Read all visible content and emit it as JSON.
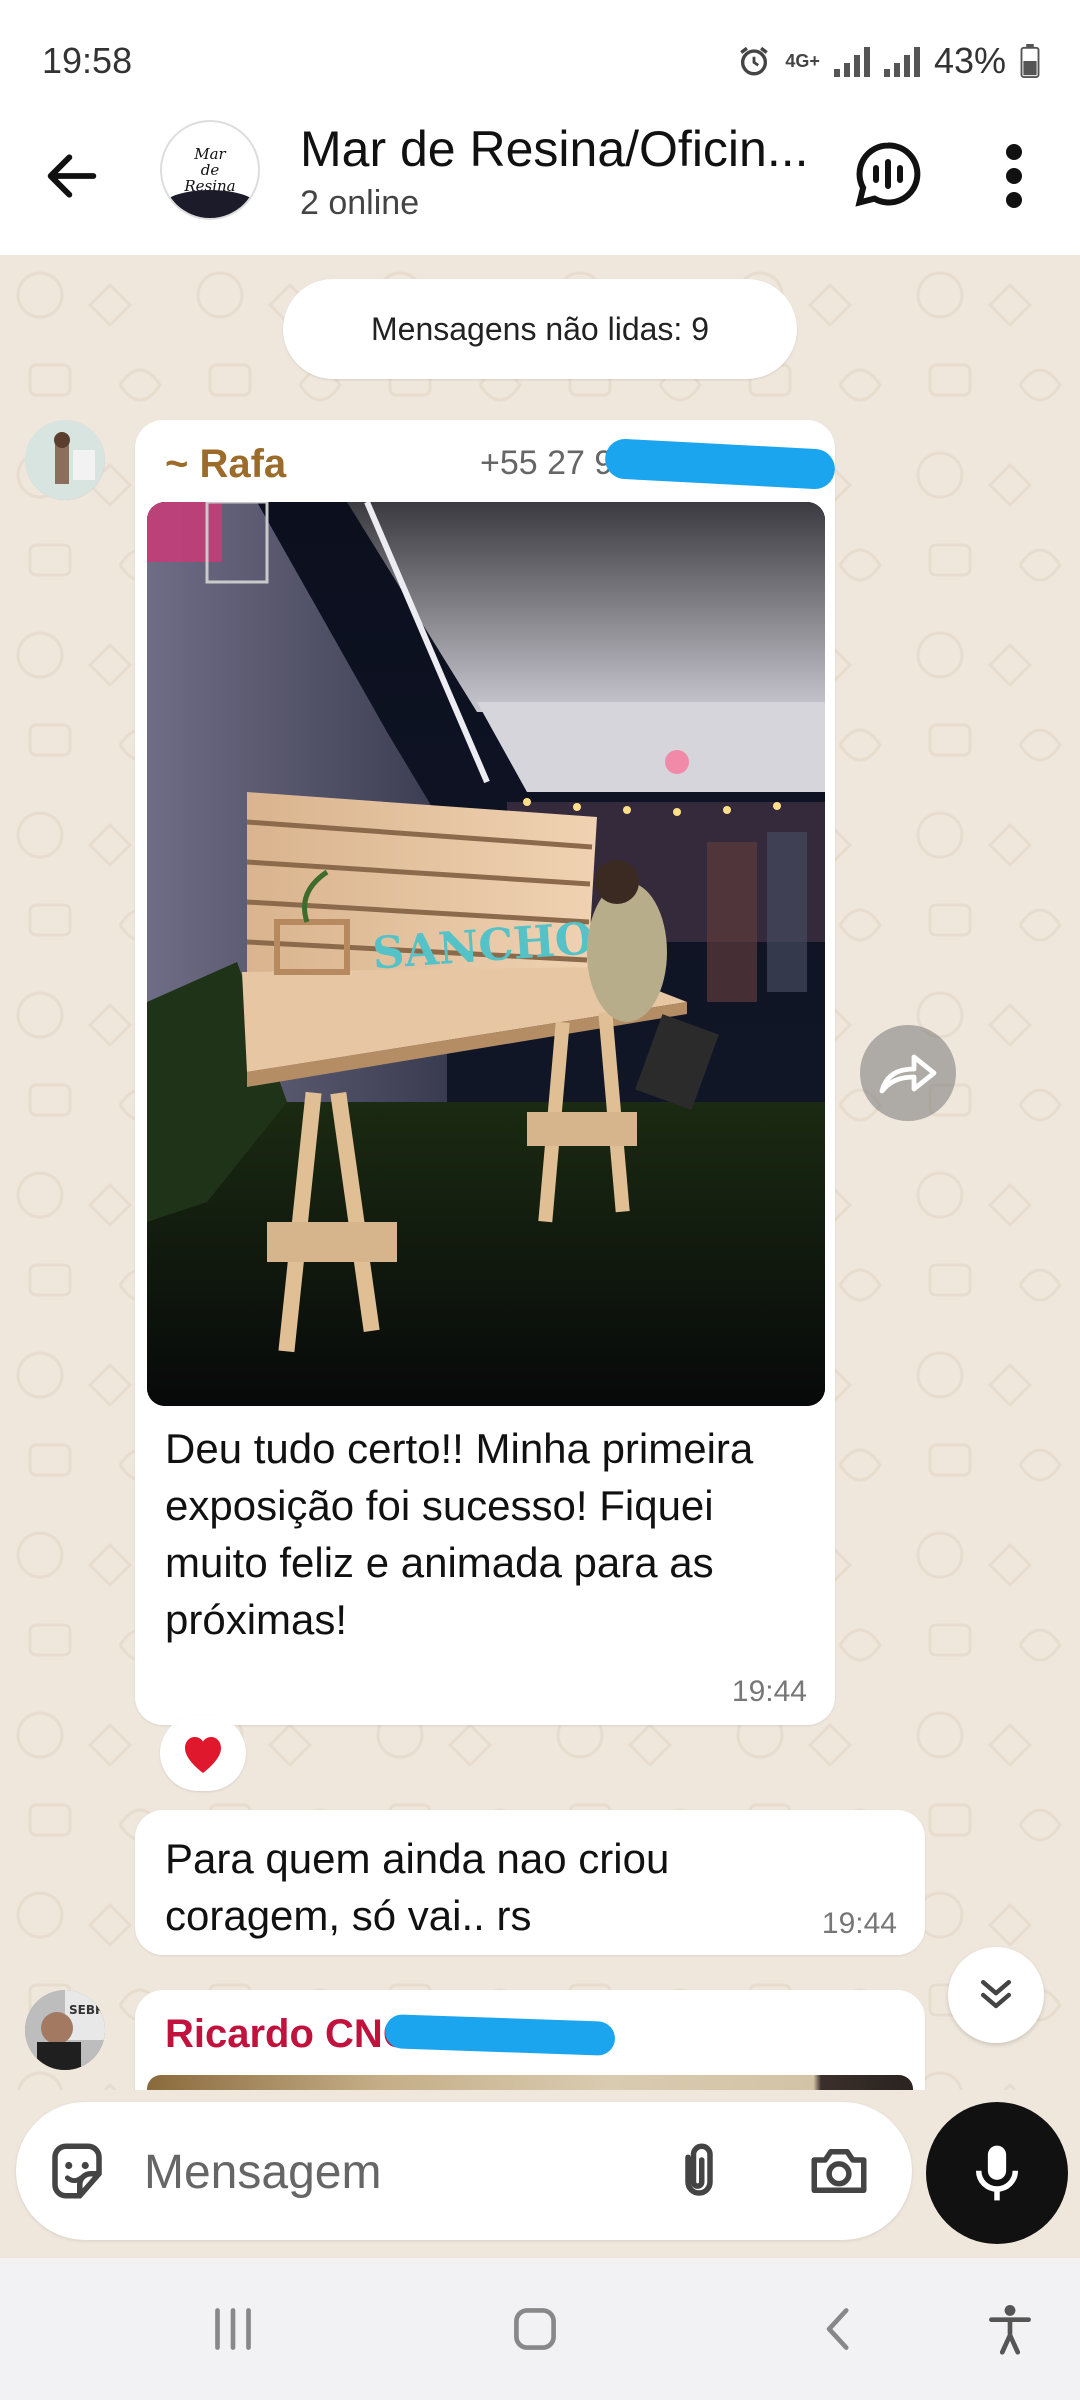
{
  "status_bar": {
    "time": "19:58",
    "network": "4G+",
    "battery": "43%"
  },
  "header": {
    "title": "Mar de Resina/Oficin...",
    "subtitle": "2 online",
    "avatar_logo_lines": [
      "Mar",
      "de",
      "Resina"
    ]
  },
  "chat": {
    "unread_label": "Mensagens não lidas: 9",
    "messages": [
      {
        "sender": "~ Rafa",
        "phone": "+55 27 9",
        "photo_sign_text": "SANCHO",
        "text": "Deu tudo certo!! Minha primeira exposição foi sucesso! Fiquei muito feliz e animada para as próximas!",
        "time": "19:44",
        "reaction": "❤️"
      },
      {
        "text": "Para quem ainda nao criou coragem, só vai.. rs",
        "time": "19:44"
      },
      {
        "sender": "Ricardo CNC"
      }
    ]
  },
  "composer": {
    "placeholder": "Mensagem"
  },
  "colors": {
    "chat_background": "#efe7dc",
    "rafa_name": "#9c6b2a",
    "ricardo_name": "#c0123c",
    "redaction": "#1aa5ee"
  },
  "icons": {
    "back": "arrow-left-icon",
    "voice_chat": "voice-chat-icon",
    "more": "more-vertical-icon",
    "forward": "forward-icon",
    "scroll_down": "double-chevron-down-icon",
    "sticker": "sticker-icon",
    "attach": "paperclip-icon",
    "camera": "camera-icon",
    "mic": "microphone-icon"
  }
}
